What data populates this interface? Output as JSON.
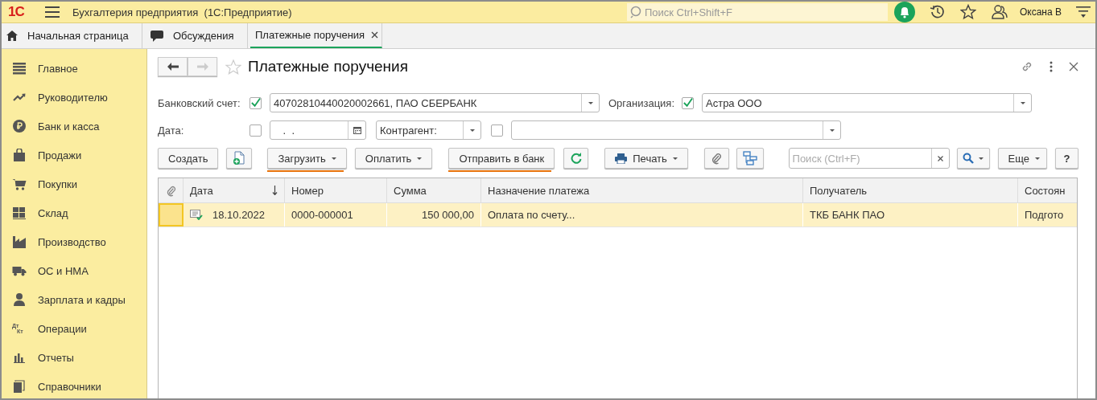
{
  "app": {
    "logo": "1С",
    "title": "Бухгалтерия предприятия  (1С:Предприятие)",
    "search_placeholder": "Поиск Ctrl+Shift+F",
    "user": "Оксана В"
  },
  "tabs": [
    {
      "label": "Начальная страница",
      "kind": "home",
      "selected": false,
      "closable": false
    },
    {
      "label": "Обсуждения",
      "kind": "chat",
      "selected": false,
      "closable": false
    },
    {
      "label": "Платежные поручения",
      "kind": "plain",
      "selected": true,
      "closable": true
    }
  ],
  "sidebar": {
    "items": [
      {
        "label": "Главное",
        "kind": "menu"
      },
      {
        "label": "Руководителю",
        "kind": "trend"
      },
      {
        "label": "Банк и касса",
        "kind": "ruble"
      },
      {
        "label": "Продажи",
        "kind": "bag"
      },
      {
        "label": "Покупки",
        "kind": "cart"
      },
      {
        "label": "Склад",
        "kind": "warehouse"
      },
      {
        "label": "Производство",
        "kind": "factory"
      },
      {
        "label": "ОС и НМА",
        "kind": "truck"
      },
      {
        "label": "Зарплата и кадры",
        "kind": "person"
      },
      {
        "label": "Операции",
        "kind": "dtkt",
        "icon_text": [
          "Дт",
          "Кт"
        ]
      },
      {
        "label": "Отчеты",
        "kind": "chart"
      },
      {
        "label": "Справочники",
        "kind": "books"
      }
    ]
  },
  "form": {
    "title": "Платежные поручения",
    "bank_account": {
      "label": "Банковский счет:",
      "checked": true,
      "value": "40702810440020002661, ПАО СБЕРБАНК"
    },
    "organization": {
      "label": "Организация:",
      "checked": true,
      "value": "Астра ООО"
    },
    "date": {
      "label": "Дата:",
      "checked": false,
      "value": " .  ."
    },
    "counterparty": {
      "select": "Контрагент:",
      "checked": false
    },
    "toolbar": [
      {
        "kind": "text",
        "label": "Создать",
        "dropdown": false,
        "underlined": false
      },
      {
        "kind": "new-doc",
        "dropdown": false,
        "underlined": false
      },
      {
        "kind": "text",
        "label": "Загрузить",
        "dropdown": true,
        "underlined": true
      },
      {
        "kind": "text",
        "label": "Оплатить",
        "dropdown": true,
        "underlined": false
      },
      {
        "kind": "text",
        "label": "Отправить в банк",
        "dropdown": false,
        "underlined": true
      },
      {
        "kind": "refresh",
        "dropdown": false,
        "underlined": false
      },
      {
        "kind": "print",
        "label": "Печать",
        "dropdown": true,
        "underlined": false
      },
      {
        "kind": "attach",
        "dropdown": false,
        "underlined": false
      },
      {
        "kind": "structure",
        "dropdown": false,
        "underlined": false
      }
    ],
    "search_placeholder": "Поиск (Ctrl+F)",
    "more": "Еще",
    "help": "?"
  },
  "table": {
    "columns": [
      {
        "kind": "attach"
      },
      {
        "label": "Дата",
        "kind": "sort"
      },
      {
        "label": "Номер"
      },
      {
        "label": "Сумма"
      },
      {
        "label": "Назначение платежа"
      },
      {
        "label": "Получатель"
      },
      {
        "label": "Состоян"
      }
    ],
    "rows": [
      {
        "selected": true,
        "cells": [
          "",
          "18.10.2022",
          "0000-000001",
          "150 000,00",
          "Оплата по счету...",
          "ТКБ БАНК ПАО",
          "Подгото"
        ]
      }
    ]
  }
}
